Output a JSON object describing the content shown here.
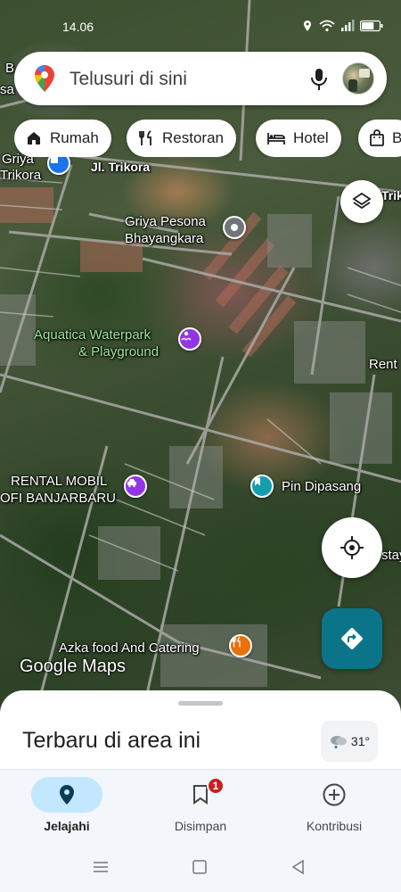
{
  "status": {
    "time": "14.06",
    "battery_level": 0.7
  },
  "search": {
    "placeholder": "Telusuri di sini"
  },
  "chips": [
    {
      "label": "Rumah",
      "icon": "home-icon"
    },
    {
      "label": "Restoran",
      "icon": "restaurant-icon"
    },
    {
      "label": "Hotel",
      "icon": "hotel-icon"
    },
    {
      "label": "B",
      "icon": "shopping-bag-icon"
    }
  ],
  "map": {
    "labels": {
      "jl_trikora": "Jl. Trikora",
      "trikora_right": "Trik",
      "griya_left": "Griya",
      "trikora_left": "Trikora",
      "b_left": "B",
      "sa_left": "sa",
      "griya_pesona_1": "Griya Pesona",
      "griya_pesona_2": "Bhayangkara",
      "aquatica_1": "Aquatica Waterpark",
      "aquatica_2": "& Playground",
      "rent_right": "Rent",
      "rental_1": "RENTAL MOBIL",
      "rental_2": "OFI BANJARBARU",
      "pin_dipasang": "Pin Dipasang",
      "stay_right": "stay",
      "azka": "Azka food And Catering"
    },
    "logo": "Google Maps"
  },
  "sheet": {
    "title": "Terbaru di area ini",
    "weather_temp": "31°"
  },
  "nav": {
    "explore": "Jelajahi",
    "saved": "Disimpan",
    "saved_badge": "1",
    "contribute": "Kontribusi"
  },
  "colors": {
    "accent_teal": "#0b7489",
    "active_pill": "#c2e7ff",
    "badge_red": "#c5221f",
    "pin_blue": "#1a73e8",
    "pin_purple": "#9334e6",
    "pin_orange": "#e8710a",
    "pin_teal": "#129eaf",
    "pin_gray": "#70757a"
  }
}
